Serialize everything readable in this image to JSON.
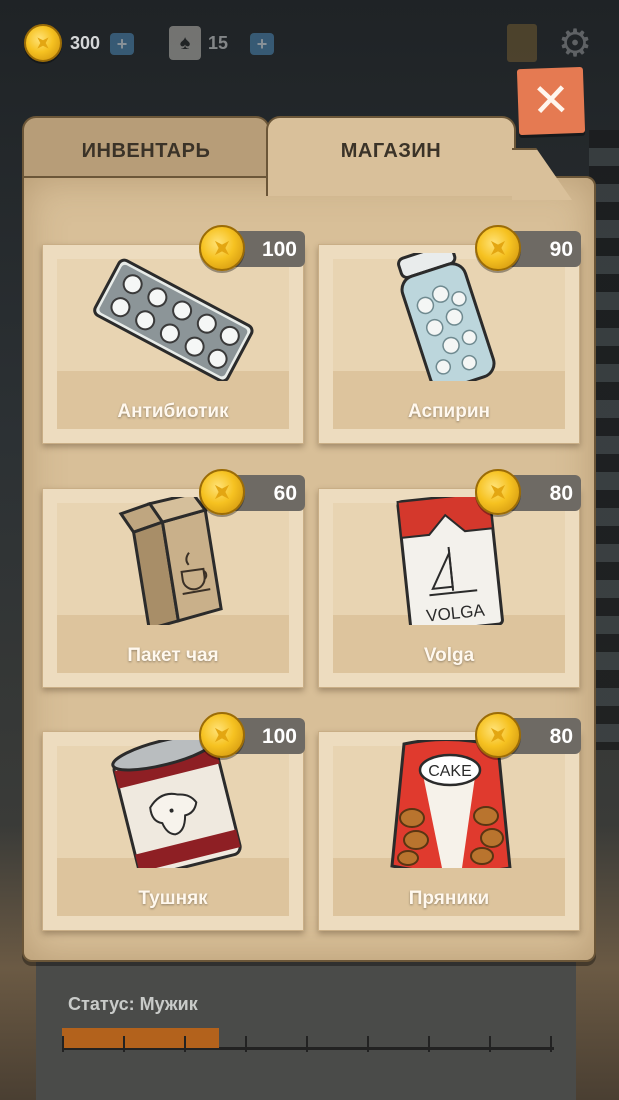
{
  "hud": {
    "coins": "300",
    "cards": "15",
    "plus_label": "+",
    "card_glyph": "♠",
    "gear_glyph": "⚙"
  },
  "close": {
    "label": "✕"
  },
  "tabs": [
    {
      "label": "ИНВЕНТАРЬ",
      "active": false
    },
    {
      "label": "МАГАЗИН",
      "active": true
    }
  ],
  "items": [
    {
      "name": "Антибиотик",
      "price": "100",
      "icon": "pill-blister-icon"
    },
    {
      "name": "Аспирин",
      "price": "90",
      "icon": "pill-bottle-icon"
    },
    {
      "name": "Пакет чая",
      "price": "60",
      "icon": "tea-bag-icon"
    },
    {
      "name": "Volga",
      "price": "80",
      "icon": "cigarette-pack-icon",
      "pack_text": "VOLGA"
    },
    {
      "name": "Тушняк",
      "price": "100",
      "icon": "canned-meat-icon"
    },
    {
      "name": "Пряники",
      "price": "80",
      "icon": "gingerbread-bag-icon",
      "pack_text": "CAKE"
    }
  ],
  "status": {
    "label": "Статус: Мужик",
    "progress": 0.32
  },
  "colors": {
    "coin": "#f6c221",
    "close": "#e57a52",
    "folder": "#d8bf98",
    "progress": "#b3621c"
  }
}
